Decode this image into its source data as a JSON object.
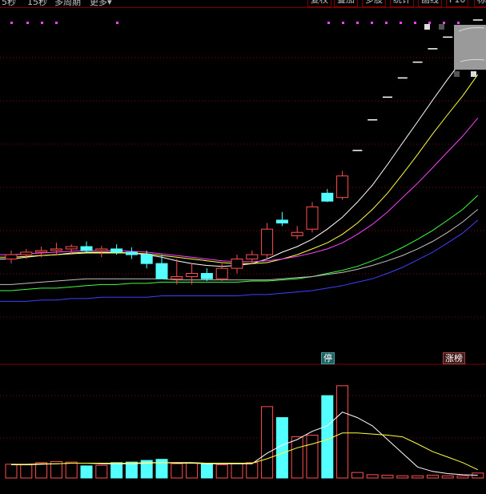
{
  "toolbar": {
    "period_labels": [
      "5秒",
      "15秒",
      "多周期",
      "更多"
    ],
    "more_arrow": "▾",
    "buttons": [
      "复权",
      "叠加",
      "多股",
      "统计",
      "画线",
      "F10",
      "标"
    ]
  },
  "badges": {
    "ting": "停",
    "zhangting": "涨榜"
  },
  "colors": {
    "background": "#000000",
    "grid": "#800000",
    "up_candle": "#ff5050",
    "down_candle": "#54ffff",
    "ma_white": "#ffffff",
    "ma_yellow": "#ffff40",
    "ma_magenta": "#ff40ff",
    "ma_green": "#40ff40",
    "ma_blue": "#4040ff",
    "ma_gray": "#c0c0c0"
  },
  "icons": {
    "marker": "small-magenta-square",
    "thumbnail": "mini-chart-thumbnail"
  },
  "chart_data": {
    "type": "candlestick",
    "candles": [
      {
        "o": 1,
        "h": 1.1,
        "l": 0.95,
        "c": 1.05,
        "v": 25
      },
      {
        "o": 1.05,
        "h": 1.12,
        "l": 1,
        "c": 1.08,
        "v": 24
      },
      {
        "o": 1.08,
        "h": 1.15,
        "l": 1.02,
        "c": 1.1,
        "v": 28
      },
      {
        "o": 1.1,
        "h": 1.2,
        "l": 1.05,
        "c": 1.12,
        "v": 30
      },
      {
        "o": 1.12,
        "h": 1.18,
        "l": 1.05,
        "c": 1.15,
        "v": 29
      },
      {
        "o": 1.15,
        "h": 1.22,
        "l": 1.08,
        "c": 1.1,
        "v": 22
      },
      {
        "o": 1.1,
        "h": 1.16,
        "l": 1.02,
        "c": 1.12,
        "v": 23
      },
      {
        "o": 1.12,
        "h": 1.18,
        "l": 1.05,
        "c": 1.08,
        "v": 28
      },
      {
        "o": 1.08,
        "h": 1.14,
        "l": 1,
        "c": 1.05,
        "v": 29
      },
      {
        "o": 1.05,
        "h": 1.1,
        "l": 0.9,
        "c": 0.95,
        "v": 32
      },
      {
        "o": 0.95,
        "h": 1.05,
        "l": 0.9,
        "c": 0.8,
        "v": 34
      },
      {
        "o": 0.8,
        "h": 1,
        "l": 0.75,
        "c": 0.82,
        "v": 26
      },
      {
        "o": 0.82,
        "h": 0.95,
        "l": 0.75,
        "c": 0.85,
        "v": 27
      },
      {
        "o": 0.85,
        "h": 0.9,
        "l": 0.78,
        "c": 0.8,
        "v": 25
      },
      {
        "o": 0.8,
        "h": 0.95,
        "l": 0.78,
        "c": 0.9,
        "v": 24
      },
      {
        "o": 0.9,
        "h": 1.05,
        "l": 0.85,
        "c": 1,
        "v": 26
      },
      {
        "o": 1,
        "h": 1.1,
        "l": 0.95,
        "c": 1.05,
        "v": 28
      },
      {
        "o": 1.05,
        "h": 1.5,
        "l": 1,
        "c": 1.4,
        "v": 130
      },
      {
        "o": 1.55,
        "h": 1.7,
        "l": 1.45,
        "c": 1.5,
        "v": 110
      },
      {
        "o": 1.3,
        "h": 1.45,
        "l": 1.25,
        "c": 1.35,
        "v": 75
      },
      {
        "o": 1.4,
        "h": 1.9,
        "l": 1.35,
        "c": 1.8,
        "v": 78
      },
      {
        "o": 2.1,
        "h": 2.2,
        "l": 1.9,
        "c": 1.92,
        "v": 150
      },
      {
        "o": 2.0,
        "h": 2.7,
        "l": 1.95,
        "c": 2.55,
        "v": 168
      },
      {
        "o": 3.4,
        "h": 3.4,
        "l": 3.4,
        "c": 3.4,
        "v": 10
      },
      {
        "o": 4.8,
        "h": 4.8,
        "l": 4.8,
        "c": 4.8,
        "v": 6
      },
      {
        "o": 6.2,
        "h": 6.2,
        "l": 6.2,
        "c": 6.2,
        "v": 5
      },
      {
        "o": 7.7,
        "h": 7.7,
        "l": 7.7,
        "c": 7.7,
        "v": 4
      },
      {
        "o": 9.2,
        "h": 9.2,
        "l": 9.2,
        "c": 9.2,
        "v": 4
      },
      {
        "o": 10.7,
        "h": 10.7,
        "l": 10.7,
        "c": 10.7,
        "v": 5
      },
      {
        "o": 12.2,
        "h": 12.2,
        "l": 12.2,
        "c": 12.2,
        "v": 4
      },
      {
        "o": 13.6,
        "h": 13.6,
        "l": 13.6,
        "c": 13.6,
        "v": 4
      },
      {
        "o": 14.8,
        "h": 14.8,
        "l": 14.8,
        "c": 14.8,
        "v": 9
      }
    ],
    "moving_averages": [
      {
        "color_key": "ma_white",
        "values": [
          1.0,
          1.02,
          1.04,
          1.05,
          1.07,
          1.08,
          1.08,
          1.08,
          1.07,
          1.05,
          1.02,
          0.98,
          0.95,
          0.93,
          0.92,
          0.93,
          0.95,
          1.0,
          1.08,
          1.15,
          1.25,
          1.4,
          1.6,
          1.9,
          2.3,
          2.9,
          3.7,
          4.7,
          6.0,
          7.6,
          9.5,
          12.0
        ]
      },
      {
        "color_key": "ma_yellow",
        "values": [
          1.02,
          1.03,
          1.04,
          1.05,
          1.06,
          1.07,
          1.07,
          1.07,
          1.07,
          1.06,
          1.04,
          1.02,
          1.0,
          0.98,
          0.96,
          0.95,
          0.95,
          0.96,
          1.0,
          1.05,
          1.12,
          1.2,
          1.32,
          1.5,
          1.75,
          2.1,
          2.6,
          3.25,
          4.1,
          5.1,
          6.3,
          8.0
        ]
      },
      {
        "color_key": "ma_magenta",
        "values": [
          1.05,
          1.06,
          1.07,
          1.08,
          1.09,
          1.1,
          1.1,
          1.1,
          1.09,
          1.08,
          1.06,
          1.04,
          1.02,
          1.0,
          0.98,
          0.97,
          0.97,
          0.98,
          1.0,
          1.03,
          1.07,
          1.12,
          1.2,
          1.32,
          1.48,
          1.7,
          2.0,
          2.35,
          2.8,
          3.35,
          4.0,
          4.9
        ]
      },
      {
        "color_key": "ma_green",
        "values": [
          0.7,
          0.71,
          0.72,
          0.72,
          0.73,
          0.74,
          0.75,
          0.75,
          0.76,
          0.76,
          0.77,
          0.77,
          0.77,
          0.77,
          0.77,
          0.77,
          0.78,
          0.78,
          0.79,
          0.8,
          0.82,
          0.85,
          0.88,
          0.92,
          0.98,
          1.05,
          1.14,
          1.25,
          1.38,
          1.55,
          1.75,
          2.05
        ]
      },
      {
        "color_key": "ma_gray",
        "values": [
          0.75,
          0.76,
          0.77,
          0.78,
          0.79,
          0.8,
          0.8,
          0.8,
          0.8,
          0.8,
          0.8,
          0.79,
          0.79,
          0.79,
          0.79,
          0.79,
          0.79,
          0.79,
          0.8,
          0.81,
          0.82,
          0.84,
          0.86,
          0.89,
          0.93,
          0.98,
          1.04,
          1.12,
          1.22,
          1.35,
          1.52,
          1.75
        ]
      },
      {
        "color_key": "ma_blue",
        "values": [
          0.62,
          0.62,
          0.63,
          0.63,
          0.64,
          0.64,
          0.65,
          0.65,
          0.65,
          0.65,
          0.66,
          0.66,
          0.66,
          0.66,
          0.66,
          0.66,
          0.67,
          0.67,
          0.68,
          0.69,
          0.7,
          0.72,
          0.74,
          0.77,
          0.8,
          0.85,
          0.91,
          0.99,
          1.08,
          1.2,
          1.34,
          1.55
        ]
      }
    ],
    "volume_ma": [
      {
        "color_key": "ma_white",
        "values": [
          24,
          24,
          25,
          26,
          27,
          27,
          26,
          26,
          26,
          27,
          28,
          27,
          27,
          26,
          26,
          26,
          26,
          45,
          60,
          70,
          85,
          95,
          120,
          110,
          95,
          70,
          45,
          20,
          12,
          8,
          6,
          5
        ]
      },
      {
        "color_key": "ma_yellow",
        "values": [
          25,
          25,
          26,
          26,
          27,
          27,
          27,
          27,
          27,
          28,
          28,
          28,
          28,
          27,
          27,
          27,
          27,
          35,
          45,
          55,
          62,
          70,
          82,
          82,
          80,
          78,
          75,
          62,
          48,
          38,
          28,
          15
        ]
      }
    ],
    "price_range": [
      0.4,
      15.2
    ],
    "volume_range": [
      0,
      175
    ]
  }
}
